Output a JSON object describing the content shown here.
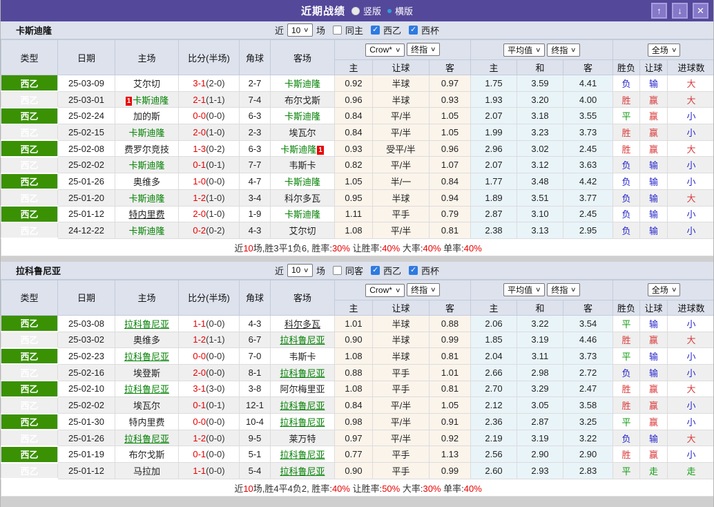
{
  "title_bar": {
    "title": "近期战绩",
    "radio_vertical": "竖版",
    "radio_horizontal": "横版",
    "buttons": {
      "up": "↑",
      "down": "↓",
      "close": "✕"
    }
  },
  "colors": {
    "title_bar_purple": "#54489a",
    "league_green": "#3a9104",
    "team_green": "#008000",
    "score_red": "#e80000",
    "result_win_red": "#d93a3a",
    "result_draw_green": "#109b10",
    "result_lose_blue": "#2626cc",
    "checkbox_blue": "#2e7ae0"
  },
  "result_color_map": {
    "胜": "win",
    "赢": "win",
    "大": "win",
    "平": "draw",
    "走": "draw",
    "负": "lose",
    "输": "lose",
    "小": "lose"
  },
  "table_headers": {
    "main": [
      "类型",
      "日期",
      "主场",
      "比分(半场)",
      "角球",
      "客场"
    ],
    "sub": [
      "主",
      "让球",
      "客",
      "主",
      "和",
      "客",
      "胜负",
      "让球",
      "进球数"
    ],
    "selects": {
      "odds_source": "Crow*",
      "odds_time": "终指",
      "avg_source": "平均值",
      "avg_time": "终指",
      "scope": "全场"
    }
  },
  "sections": [
    {
      "team": "卡斯迪隆",
      "controls": {
        "near_label": "近",
        "near_value": "10",
        "games_label": "场",
        "same_label": "同主",
        "same_checked": false,
        "league_label": "西乙",
        "league_checked": true,
        "cup_label": "西杯",
        "cup_checked": true
      },
      "rows": [
        {
          "league": "西乙",
          "date": "25-03-09",
          "home": {
            "name": "艾尔切"
          },
          "score": "3-1",
          "half": "(2-0)",
          "corner": "2-7",
          "away": {
            "name": "卡斯迪隆",
            "green": true
          },
          "odds": [
            "0.92",
            "半球",
            "0.97"
          ],
          "avg": [
            "1.75",
            "3.59",
            "4.41"
          ],
          "results": [
            "负",
            "输",
            "大"
          ]
        },
        {
          "league": "西乙",
          "date": "25-03-01",
          "home": {
            "name": "卡斯迪隆",
            "green": true,
            "badge": "1",
            "badge_pos": "before"
          },
          "score": "2-1",
          "half": "(1-1)",
          "corner": "7-4",
          "away": {
            "name": "布尔戈斯"
          },
          "odds": [
            "0.96",
            "半球",
            "0.93"
          ],
          "avg": [
            "1.93",
            "3.20",
            "4.00"
          ],
          "results": [
            "胜",
            "赢",
            "大"
          ]
        },
        {
          "league": "西乙",
          "date": "25-02-24",
          "home": {
            "name": "加的斯"
          },
          "score": "0-0",
          "half": "(0-0)",
          "corner": "6-3",
          "away": {
            "name": "卡斯迪隆",
            "green": true
          },
          "odds": [
            "0.84",
            "平/半",
            "1.05"
          ],
          "avg": [
            "2.07",
            "3.18",
            "3.55"
          ],
          "results": [
            "平",
            "赢",
            "小"
          ]
        },
        {
          "league": "西乙",
          "date": "25-02-15",
          "home": {
            "name": "卡斯迪隆",
            "green": true
          },
          "score": "2-0",
          "half": "(1-0)",
          "corner": "2-3",
          "away": {
            "name": "埃瓦尔"
          },
          "odds": [
            "0.84",
            "平/半",
            "1.05"
          ],
          "avg": [
            "1.99",
            "3.23",
            "3.73"
          ],
          "results": [
            "胜",
            "赢",
            "小"
          ]
        },
        {
          "league": "西乙",
          "date": "25-02-08",
          "home": {
            "name": "费罗尔竞技"
          },
          "score": "1-3",
          "half": "(0-2)",
          "corner": "6-3",
          "away": {
            "name": "卡斯迪隆",
            "green": true,
            "badge": "1",
            "badge_pos": "after"
          },
          "odds": [
            "0.93",
            "受平/半",
            "0.96"
          ],
          "avg": [
            "2.96",
            "3.02",
            "2.45"
          ],
          "results": [
            "胜",
            "赢",
            "大"
          ]
        },
        {
          "league": "西乙",
          "date": "25-02-02",
          "home": {
            "name": "卡斯迪隆",
            "green": true
          },
          "score": "0-1",
          "half": "(0-1)",
          "corner": "7-7",
          "away": {
            "name": "韦斯卡"
          },
          "odds": [
            "0.82",
            "平/半",
            "1.07"
          ],
          "avg": [
            "2.07",
            "3.12",
            "3.63"
          ],
          "results": [
            "负",
            "输",
            "小"
          ]
        },
        {
          "league": "西乙",
          "date": "25-01-26",
          "home": {
            "name": "奥维多"
          },
          "score": "1-0",
          "half": "(0-0)",
          "corner": "4-7",
          "away": {
            "name": "卡斯迪隆",
            "green": true
          },
          "odds": [
            "1.05",
            "半/一",
            "0.84"
          ],
          "avg": [
            "1.77",
            "3.48",
            "4.42"
          ],
          "results": [
            "负",
            "输",
            "小"
          ]
        },
        {
          "league": "西乙",
          "date": "25-01-20",
          "home": {
            "name": "卡斯迪隆",
            "green": true
          },
          "score": "1-2",
          "half": "(1-0)",
          "corner": "3-4",
          "away": {
            "name": "科尔多瓦"
          },
          "odds": [
            "0.95",
            "半球",
            "0.94"
          ],
          "avg": [
            "1.89",
            "3.51",
            "3.77"
          ],
          "results": [
            "负",
            "输",
            "大"
          ]
        },
        {
          "league": "西乙",
          "date": "25-01-12",
          "home": {
            "name": "特内里费",
            "underline": true
          },
          "score": "2-0",
          "half": "(1-0)",
          "corner": "1-9",
          "away": {
            "name": "卡斯迪隆",
            "green": true
          },
          "odds": [
            "1.11",
            "平手",
            "0.79"
          ],
          "avg": [
            "2.87",
            "3.10",
            "2.45"
          ],
          "results": [
            "负",
            "输",
            "小"
          ]
        },
        {
          "league": "西乙",
          "date": "24-12-22",
          "home": {
            "name": "卡斯迪隆",
            "green": true
          },
          "score": "0-2",
          "half": "(0-2)",
          "corner": "4-3",
          "away": {
            "name": "艾尔切"
          },
          "odds": [
            "1.08",
            "平/半",
            "0.81"
          ],
          "avg": [
            "2.38",
            "3.13",
            "2.95"
          ],
          "results": [
            "负",
            "输",
            "小"
          ]
        }
      ],
      "summary": [
        {
          "t": "近"
        },
        {
          "t": "10",
          "red": true
        },
        {
          "t": "场,胜3平1负6, 胜率:"
        },
        {
          "t": "30%",
          "red": true
        },
        {
          "t": " 让胜率:"
        },
        {
          "t": "40%",
          "red": true
        },
        {
          "t": " 大率:"
        },
        {
          "t": "40%",
          "red": true
        },
        {
          "t": " 单率:"
        },
        {
          "t": "40%",
          "red": true
        }
      ]
    },
    {
      "team": "拉科鲁尼亚",
      "controls": {
        "near_label": "近",
        "near_value": "10",
        "games_label": "场",
        "same_label": "同客",
        "same_checked": false,
        "league_label": "西乙",
        "league_checked": true,
        "cup_label": "西杯",
        "cup_checked": true
      },
      "rows": [
        {
          "league": "西乙",
          "date": "25-03-08",
          "home": {
            "name": "拉科鲁尼亚",
            "green": true,
            "underline": true
          },
          "score": "1-1",
          "half": "(0-0)",
          "corner": "4-3",
          "away": {
            "name": "科尔多瓦",
            "underline": true
          },
          "odds": [
            "1.01",
            "半球",
            "0.88"
          ],
          "avg": [
            "2.06",
            "3.22",
            "3.54"
          ],
          "results": [
            "平",
            "输",
            "小"
          ]
        },
        {
          "league": "西乙",
          "date": "25-03-02",
          "home": {
            "name": "奥维多"
          },
          "score": "1-2",
          "half": "(1-1)",
          "corner": "6-7",
          "away": {
            "name": "拉科鲁尼亚",
            "green": true,
            "underline": true
          },
          "odds": [
            "0.90",
            "半球",
            "0.99"
          ],
          "avg": [
            "1.85",
            "3.19",
            "4.46"
          ],
          "results": [
            "胜",
            "赢",
            "大"
          ]
        },
        {
          "league": "西乙",
          "date": "25-02-23",
          "home": {
            "name": "拉科鲁尼亚",
            "green": true,
            "underline": true
          },
          "score": "0-0",
          "half": "(0-0)",
          "corner": "7-0",
          "away": {
            "name": "韦斯卡"
          },
          "odds": [
            "1.08",
            "半球",
            "0.81"
          ],
          "avg": [
            "2.04",
            "3.11",
            "3.73"
          ],
          "results": [
            "平",
            "输",
            "小"
          ]
        },
        {
          "league": "西乙",
          "date": "25-02-16",
          "home": {
            "name": "埃登斯"
          },
          "score": "2-0",
          "half": "(0-0)",
          "corner": "8-1",
          "away": {
            "name": "拉科鲁尼亚",
            "green": true,
            "underline": true
          },
          "odds": [
            "0.88",
            "平手",
            "1.01"
          ],
          "avg": [
            "2.66",
            "2.98",
            "2.72"
          ],
          "results": [
            "负",
            "输",
            "小"
          ]
        },
        {
          "league": "西乙",
          "date": "25-02-10",
          "home": {
            "name": "拉科鲁尼亚",
            "green": true,
            "underline": true
          },
          "score": "3-1",
          "half": "(3-0)",
          "corner": "3-8",
          "away": {
            "name": "阿尔梅里亚"
          },
          "odds": [
            "1.08",
            "平手",
            "0.81"
          ],
          "avg": [
            "2.70",
            "3.29",
            "2.47"
          ],
          "results": [
            "胜",
            "赢",
            "大"
          ]
        },
        {
          "league": "西乙",
          "date": "25-02-02",
          "home": {
            "name": "埃瓦尔"
          },
          "score": "0-1",
          "half": "(0-1)",
          "corner": "12-1",
          "away": {
            "name": "拉科鲁尼亚",
            "green": true,
            "underline": true
          },
          "odds": [
            "0.84",
            "平/半",
            "1.05"
          ],
          "avg": [
            "2.12",
            "3.05",
            "3.58"
          ],
          "results": [
            "胜",
            "赢",
            "小"
          ]
        },
        {
          "league": "西乙",
          "date": "25-01-30",
          "home": {
            "name": "特内里费"
          },
          "score": "0-0",
          "half": "(0-0)",
          "corner": "10-4",
          "away": {
            "name": "拉科鲁尼亚",
            "green": true,
            "underline": true
          },
          "odds": [
            "0.98",
            "平/半",
            "0.91"
          ],
          "avg": [
            "2.36",
            "2.87",
            "3.25"
          ],
          "results": [
            "平",
            "赢",
            "小"
          ]
        },
        {
          "league": "西乙",
          "date": "25-01-26",
          "home": {
            "name": "拉科鲁尼亚",
            "green": true,
            "underline": true
          },
          "score": "1-2",
          "half": "(0-0)",
          "corner": "9-5",
          "away": {
            "name": "莱万特"
          },
          "odds": [
            "0.97",
            "平/半",
            "0.92"
          ],
          "avg": [
            "2.19",
            "3.19",
            "3.22"
          ],
          "results": [
            "负",
            "输",
            "大"
          ]
        },
        {
          "league": "西乙",
          "date": "25-01-19",
          "home": {
            "name": "布尔戈斯"
          },
          "score": "0-1",
          "half": "(0-0)",
          "corner": "5-1",
          "away": {
            "name": "拉科鲁尼亚",
            "green": true,
            "underline": true
          },
          "odds": [
            "0.77",
            "平手",
            "1.13"
          ],
          "avg": [
            "2.56",
            "2.90",
            "2.90"
          ],
          "results": [
            "胜",
            "赢",
            "小"
          ]
        },
        {
          "league": "西乙",
          "date": "25-01-12",
          "home": {
            "name": "马拉加"
          },
          "score": "1-1",
          "half": "(0-0)",
          "corner": "5-4",
          "away": {
            "name": "拉科鲁尼亚",
            "green": true,
            "underline": true
          },
          "odds": [
            "0.90",
            "平手",
            "0.99"
          ],
          "avg": [
            "2.60",
            "2.93",
            "2.83"
          ],
          "results": [
            "平",
            "走",
            "走"
          ]
        }
      ],
      "summary": [
        {
          "t": "近"
        },
        {
          "t": "10",
          "red": true
        },
        {
          "t": "场,胜4平4负2, 胜率:"
        },
        {
          "t": "40%",
          "red": true
        },
        {
          "t": " 让胜率:"
        },
        {
          "t": "50%",
          "red": true
        },
        {
          "t": " 大率:"
        },
        {
          "t": "30%",
          "red": true
        },
        {
          "t": " 单率:"
        },
        {
          "t": "40%",
          "red": true
        }
      ]
    }
  ]
}
